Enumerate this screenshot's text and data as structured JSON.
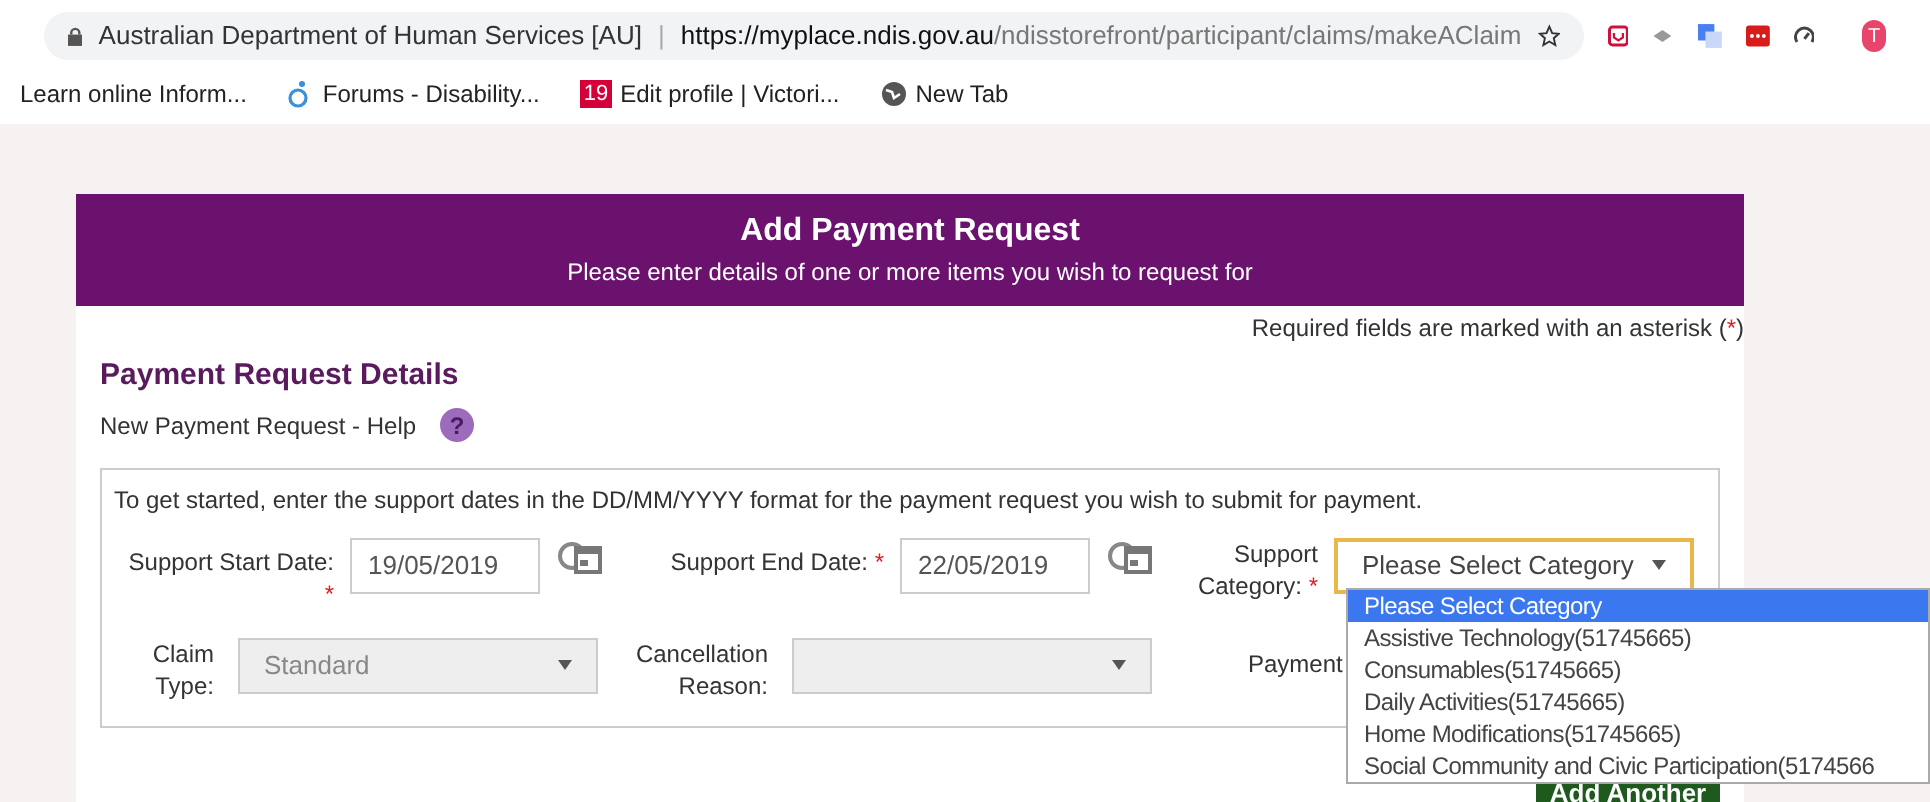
{
  "browser": {
    "site_name": "Australian Department of Human Services [AU]",
    "separator": "|",
    "url_host": "https://myplace.ndis.gov.au",
    "url_path": "/ndisstorefront/participant/claims/makeAClaim",
    "bookmarks": [
      "Learn online Inform...",
      "Forums - Disability...",
      "Edit profile | Victori...",
      "New Tab"
    ],
    "profile_initial": "T",
    "calendar_badge": "19"
  },
  "banner": {
    "title": "Add Payment Request",
    "subtitle": "Please enter details of one or more items you wish to request for"
  },
  "required_note": {
    "text": "Required fields are marked with an asterisk (",
    "mark": "*",
    "close": ")"
  },
  "section": {
    "title": "Payment Request Details",
    "help": "New Payment Request - Help",
    "help_icon": "?"
  },
  "form": {
    "instructions": "To get started, enter the support dates in the DD/MM/YYYY format for the payment request you wish to submit for payment.",
    "start_date": {
      "label": "Support Start Date:",
      "value": "19/05/2019"
    },
    "end_date": {
      "label": "Support End Date:",
      "value": "22/05/2019"
    },
    "category": {
      "label_1": "Support",
      "label_2": "Category:",
      "value": "Please Select Category",
      "expanded": true,
      "options": [
        {
          "label": "Please Select Category",
          "selected": true
        },
        {
          "label": "Assistive Technology(51745665)",
          "selected": false
        },
        {
          "label": "Consumables(51745665)",
          "selected": false
        },
        {
          "label": "Daily Activities(51745665)",
          "selected": false
        },
        {
          "label": "Home Modifications(51745665)",
          "selected": false
        },
        {
          "label": "Social Community and Civic Participation(5174566",
          "selected": false
        }
      ]
    },
    "claim_type": {
      "label_1": "Claim",
      "label_2": "Type:",
      "value": "Standard",
      "disabled": true
    },
    "cancellation": {
      "label_1": "Cancellation",
      "label_2": "Reason:",
      "disabled": true
    },
    "payment_label": "Payment"
  },
  "add_button": "Add Another"
}
